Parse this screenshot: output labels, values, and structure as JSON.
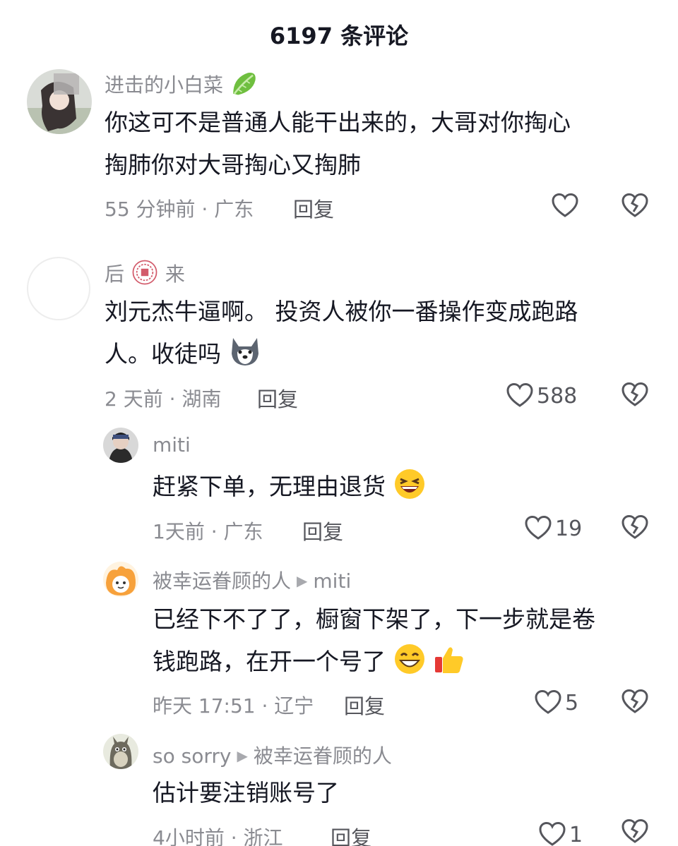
{
  "header": {
    "title": "6197 条评论"
  },
  "comments": [
    {
      "username": "进击的小白菜",
      "text_lines": [
        "你这可不是普通人能干出来的，大哥对你掏心",
        "掏肺你对大哥掏心又掏肺"
      ],
      "meta": "55 分钟前 · 广东",
      "reply_label": "回复",
      "likes": "",
      "name_emoji": "lettuce-emoji"
    },
    {
      "username_prefix": "后",
      "username_suffix": "来",
      "text_lines": [
        "刘元杰牛逼啊。 投资人被你一番操作变成跑路",
        "人。收徒吗"
      ],
      "meta": "2 天前 · 湖南",
      "reply_label": "回复",
      "likes": "588",
      "name_emoji": "seal-emoji",
      "text_emoji": "husky-emoji"
    },
    {
      "username": "miti",
      "text_lines": [
        "赶紧下单，无理由退货"
      ],
      "meta": "1天前 · 广东",
      "reply_label": "回复",
      "likes": "19",
      "text_emoji": "laughing-emoji"
    },
    {
      "username": "被幸运眷顾的人",
      "reply_to": "miti",
      "text_lines": [
        "已经下不了了，橱窗下架了，下一步就是卷",
        "钱跑路，在开一个号了"
      ],
      "meta": "昨天 17:51 · 辽宁",
      "reply_label": "回复",
      "likes": "5",
      "text_emoji": "grin-emoji thumbs-up-emoji"
    },
    {
      "username": "so sorry",
      "reply_to": "被幸运眷顾的人",
      "text_lines": [
        "估计要注销账号了"
      ],
      "meta": "4小时前 · 浙江",
      "reply_label": "回复",
      "likes": "1"
    }
  ],
  "colors": {
    "text": "#161823",
    "secondary": "#8a8b91",
    "reply": "#55565c"
  }
}
